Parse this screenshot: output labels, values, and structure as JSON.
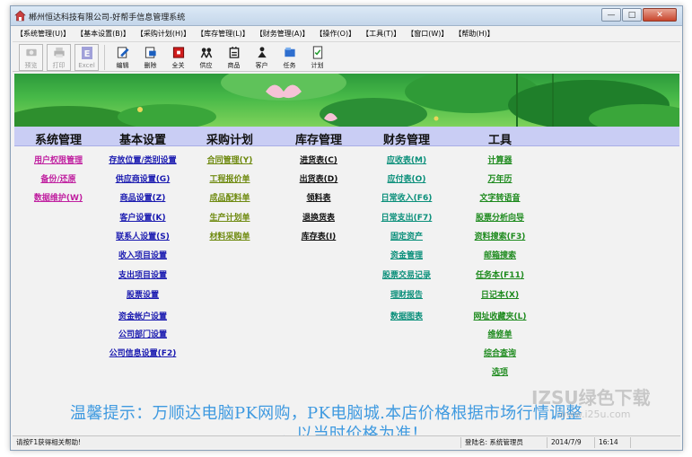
{
  "window": {
    "title": "郴州恒达科技有限公司-好帮手信息管理系统",
    "controls": [
      "—",
      "□",
      "✕"
    ]
  },
  "menu": [
    "【系统管理(U)】",
    "【基本设置(B)】",
    "【采购计划(H)】",
    "【库存管理(L)】",
    "【财务管理(A)】",
    "【操作(O)】",
    "【工具(T)】",
    "【窗口(W)】",
    "【帮助(H)】"
  ],
  "toolbar": [
    {
      "label": "预览",
      "icon": "preview-icon",
      "disabled": true
    },
    {
      "label": "打印",
      "icon": "print-icon",
      "disabled": true
    },
    {
      "label": "Excel",
      "icon": "excel-icon",
      "disabled": true
    },
    {
      "label": "编辑",
      "icon": "edit-icon",
      "disabled": false
    },
    {
      "label": "删除",
      "icon": "delete-icon",
      "disabled": false
    },
    {
      "label": "全关",
      "icon": "close-all-icon",
      "disabled": false
    },
    {
      "label": "供应",
      "icon": "supply-icon",
      "disabled": false
    },
    {
      "label": "商品",
      "icon": "goods-icon",
      "disabled": false
    },
    {
      "label": "客户",
      "icon": "customer-icon",
      "disabled": false
    },
    {
      "label": "任务",
      "icon": "task-icon",
      "disabled": false
    },
    {
      "label": "计划",
      "icon": "plan-icon",
      "disabled": false
    }
  ],
  "nav": {
    "headers": [
      "系统管理",
      "基本设置",
      "采购计划",
      "库存管理",
      "财务管理",
      "工具"
    ],
    "system": [
      "用户权限管理",
      "备份/还原",
      "数据维护(W)"
    ],
    "basic": [
      "存放位置/类别设置",
      "供应商设置(G)",
      "商品设置(Z)",
      "客户设置(K)",
      "联系人设置(S)",
      "收入项目设置",
      "支出项目设置",
      "股票设置",
      "资金帐户设置",
      "公司部门设置",
      "公司信息设置(F2)"
    ],
    "purchase": [
      "合同管理(Y)",
      "工程报价单",
      "成品配料单",
      "生产计划单",
      "材料采购单"
    ],
    "inventory": [
      "进货表(C)",
      "出货表(D)",
      "领料表",
      "退换货表",
      "库存表(I)"
    ],
    "finance": [
      "应收表(M)",
      "应付表(O)",
      "日常收入(F6)",
      "日常支出(F7)",
      "固定资产",
      "资金管理",
      "股票交易记录",
      "理财报告",
      "数据图表"
    ],
    "tools": [
      "计算器",
      "万年历",
      "文字转语音",
      "股票分析向导",
      "资料搜索(F3)",
      "邮箱搜索",
      "任务本(F11)",
      "日记本(X)",
      "网址收藏夹(L)",
      "维修单",
      "综合查询",
      "选项"
    ]
  },
  "tip": {
    "line1": "温馨提示：万顺达电脑PK网购，PK电脑城.本店价格根据市场行情调整",
    "line2": "，以当时价格为准！"
  },
  "watermark": {
    "text": "IZSU绿色下载",
    "sub": "www.i25u.com"
  },
  "status": {
    "hint": "请按F1获得相关帮助!",
    "user": "登陆名: 系统管理员",
    "date": "2014/7/9",
    "time": "16:14"
  },
  "colors": {
    "nav_header_bg": "#c9cdf4",
    "banner_green": "#47b948",
    "tip_blue": "#3f9ae0",
    "link_blue": "#1a1ab0",
    "link_magenta": "#c020a0",
    "link_olive": "#6f8a10"
  }
}
